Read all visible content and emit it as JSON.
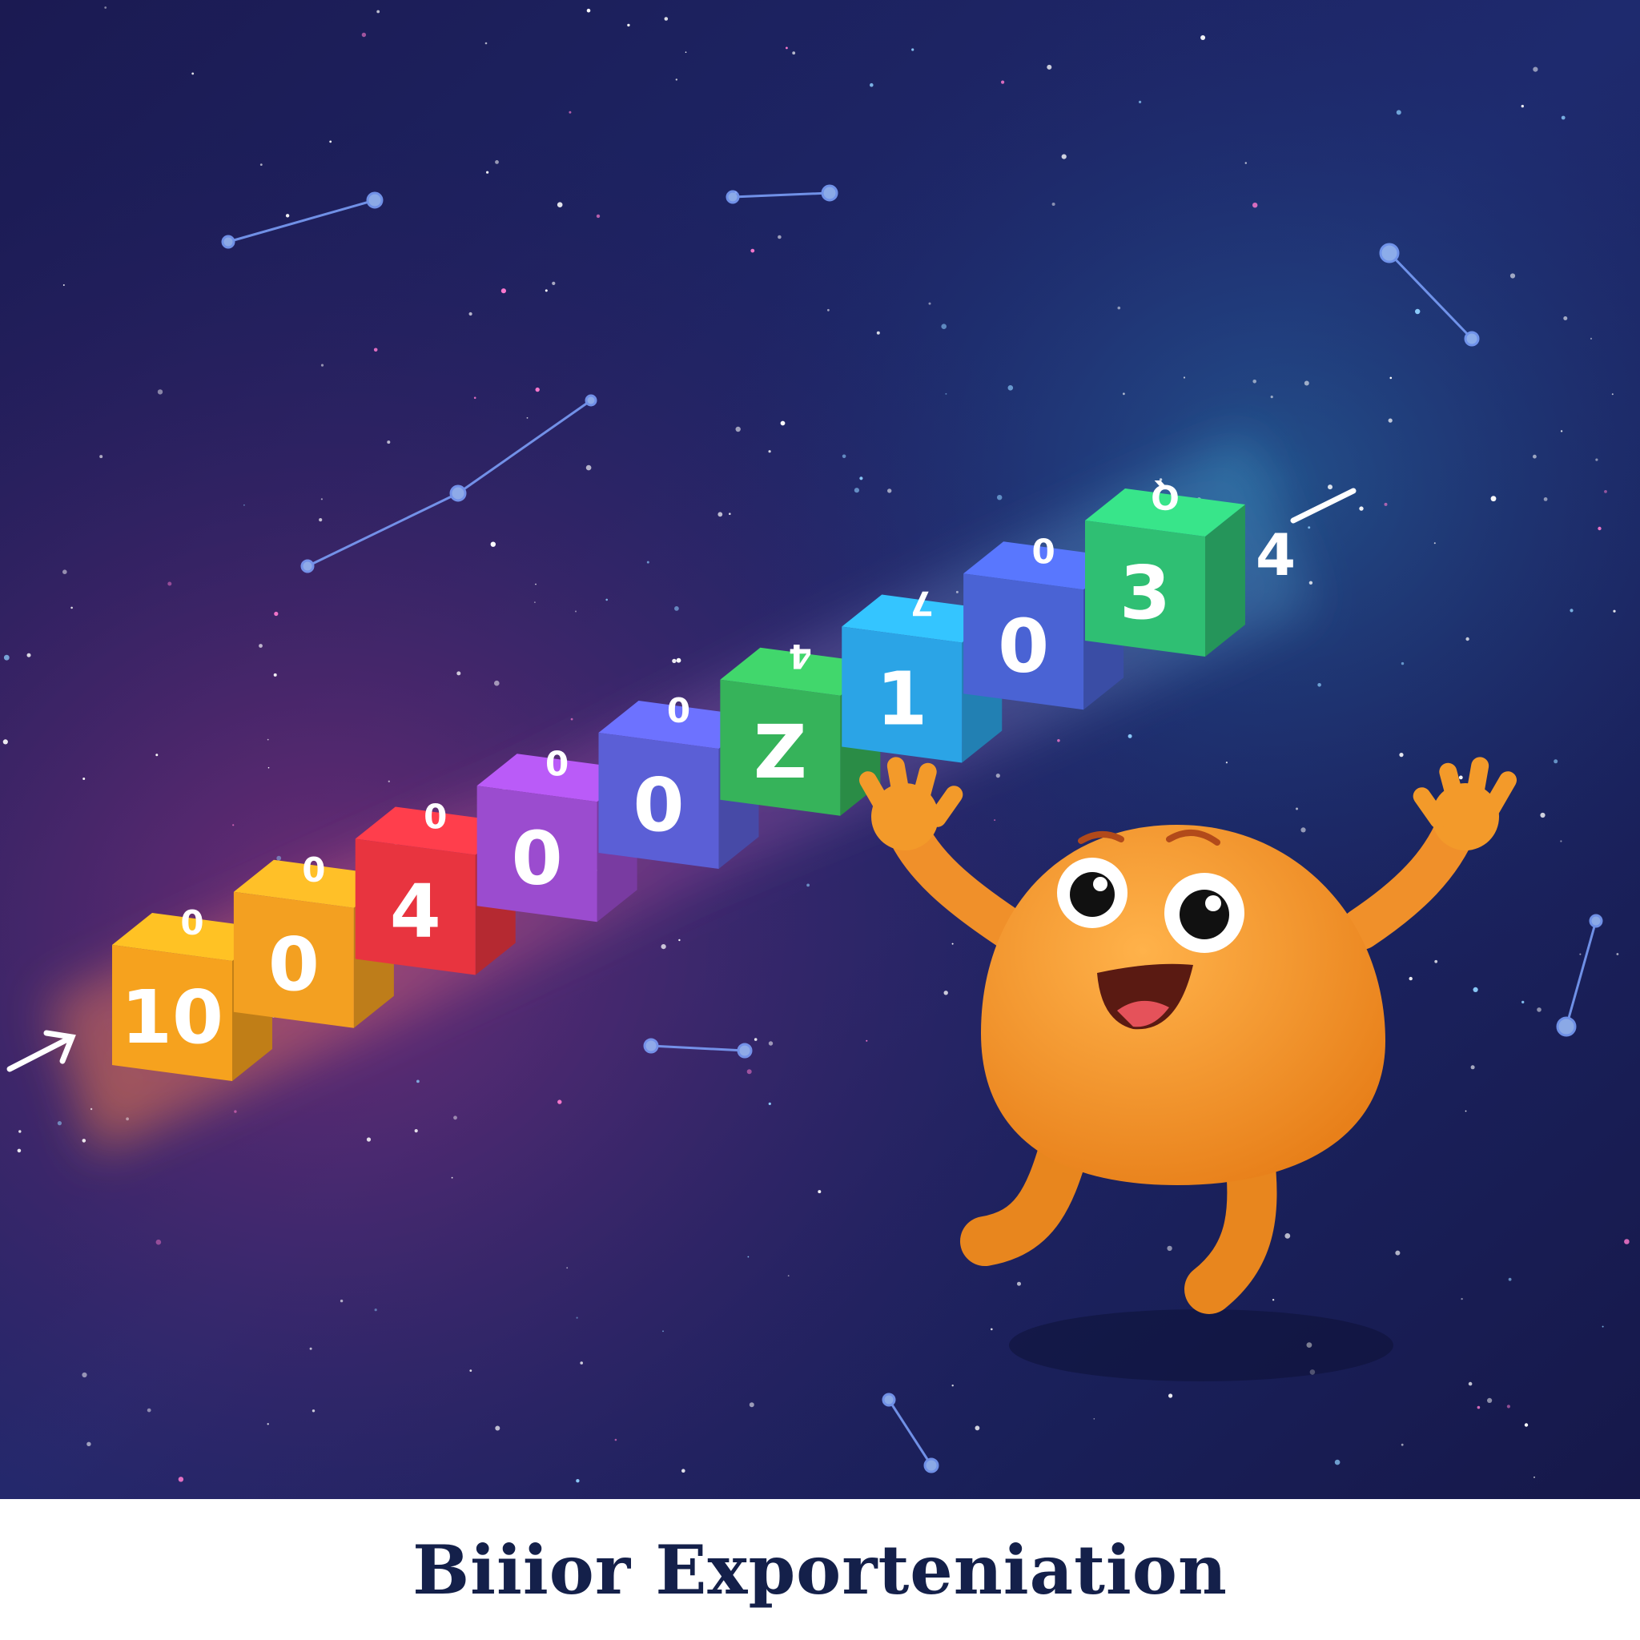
{
  "caption": "Biiior Exporteniation",
  "colors": {
    "sky_top": "#171a4e",
    "sky_bottom": "#3a1f63",
    "character": "#f39a2a",
    "caption_text": "#14204a"
  },
  "blocks": [
    {
      "front": "10",
      "top": "0",
      "color": "#f6a21e"
    },
    {
      "front": "0",
      "top": "0",
      "color": "#f3a021"
    },
    {
      "front": "4",
      "top": "0",
      "color": "#e8343f"
    },
    {
      "front": "0",
      "top": "0",
      "color": "#9b4ccf"
    },
    {
      "front": "0",
      "top": "0",
      "color": "#5b5fd6"
    },
    {
      "front": "Z",
      "top": "4",
      "color": "#36b35a"
    },
    {
      "front": "1",
      "top": "7",
      "color": "#2ba4e6"
    },
    {
      "front": "0",
      "top": "0",
      "color": "#4a63d4"
    },
    {
      "front": "3",
      "top": "Q",
      "color": "#2fbf73"
    }
  ],
  "trailing_glyph": "4",
  "icons": [
    "arrow-in-icon",
    "arrow-out-icon",
    "smiling-blob-character",
    "constellation-lines"
  ]
}
